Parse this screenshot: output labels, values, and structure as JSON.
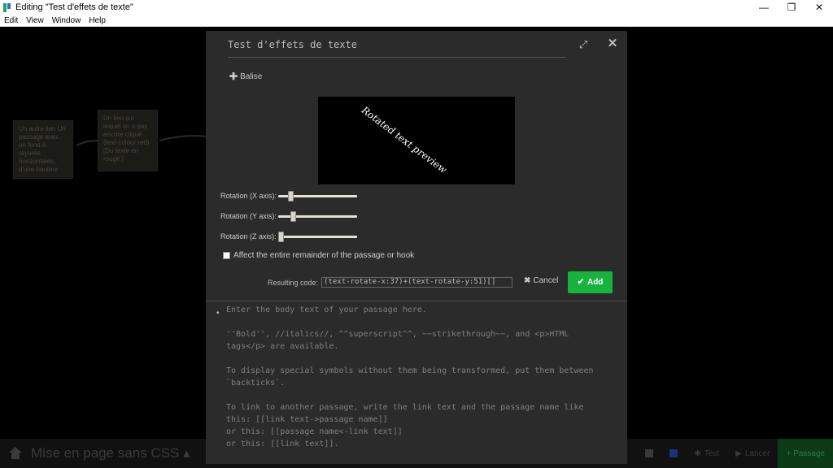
{
  "window": {
    "title": "Editing \"Test d'effets de texte\"",
    "minimize": "—",
    "restore": "❐",
    "close": "✕"
  },
  "menu": [
    "Edit",
    "View",
    "Window",
    "Help"
  ],
  "canvas": {
    "card1": "Un autre lien Un passage avec un fond à rayures horizontales, d'une hauteur",
    "card2": "Un lien sur lequel on a pas encore cliqué (text-colour:red)[Du texte en rouge.]"
  },
  "bottom_bar": {
    "story_title": "Mise en page sans CSS ▴",
    "test": "Test",
    "play": "Lancer",
    "passage": "+ Passage"
  },
  "dialog": {
    "title": "Test d'effets de texte",
    "balise_label": "Balise",
    "preview_text": "Rotated text preview",
    "rotation_x": {
      "label": "Rotation (X axis):",
      "value": 0.13
    },
    "rotation_y": {
      "label": "Rotation (Y axis):",
      "value": 0.17
    },
    "rotation_z": {
      "label": "Rotation (Z axis):",
      "value": 0.0
    },
    "affect_label": "Affect the entire remainder of the passage or hook",
    "affect_checked": false,
    "resulting_code_label": "Resulting code:",
    "resulting_code": "(text-rotate-x:37)+(text-rotate-y:51)[]",
    "cancel_label": "Cancel",
    "add_label": "Add"
  },
  "editor": {
    "lines": [
      "Enter the body text of your passage here.",
      "",
      "''Bold'', //italics//, ^^superscript^^, ~~strikethrough~~, and <p>HTML",
      "tags</p> are available.",
      "",
      "To display special symbols without them being transformed, put them between",
      "`backticks`.",
      "",
      "To link to another passage, write the link text and the passage name like",
      "this: [[link text->passage name]]",
      "or this: [[passage name<-link text]]",
      "or this: [[link text]]."
    ]
  }
}
